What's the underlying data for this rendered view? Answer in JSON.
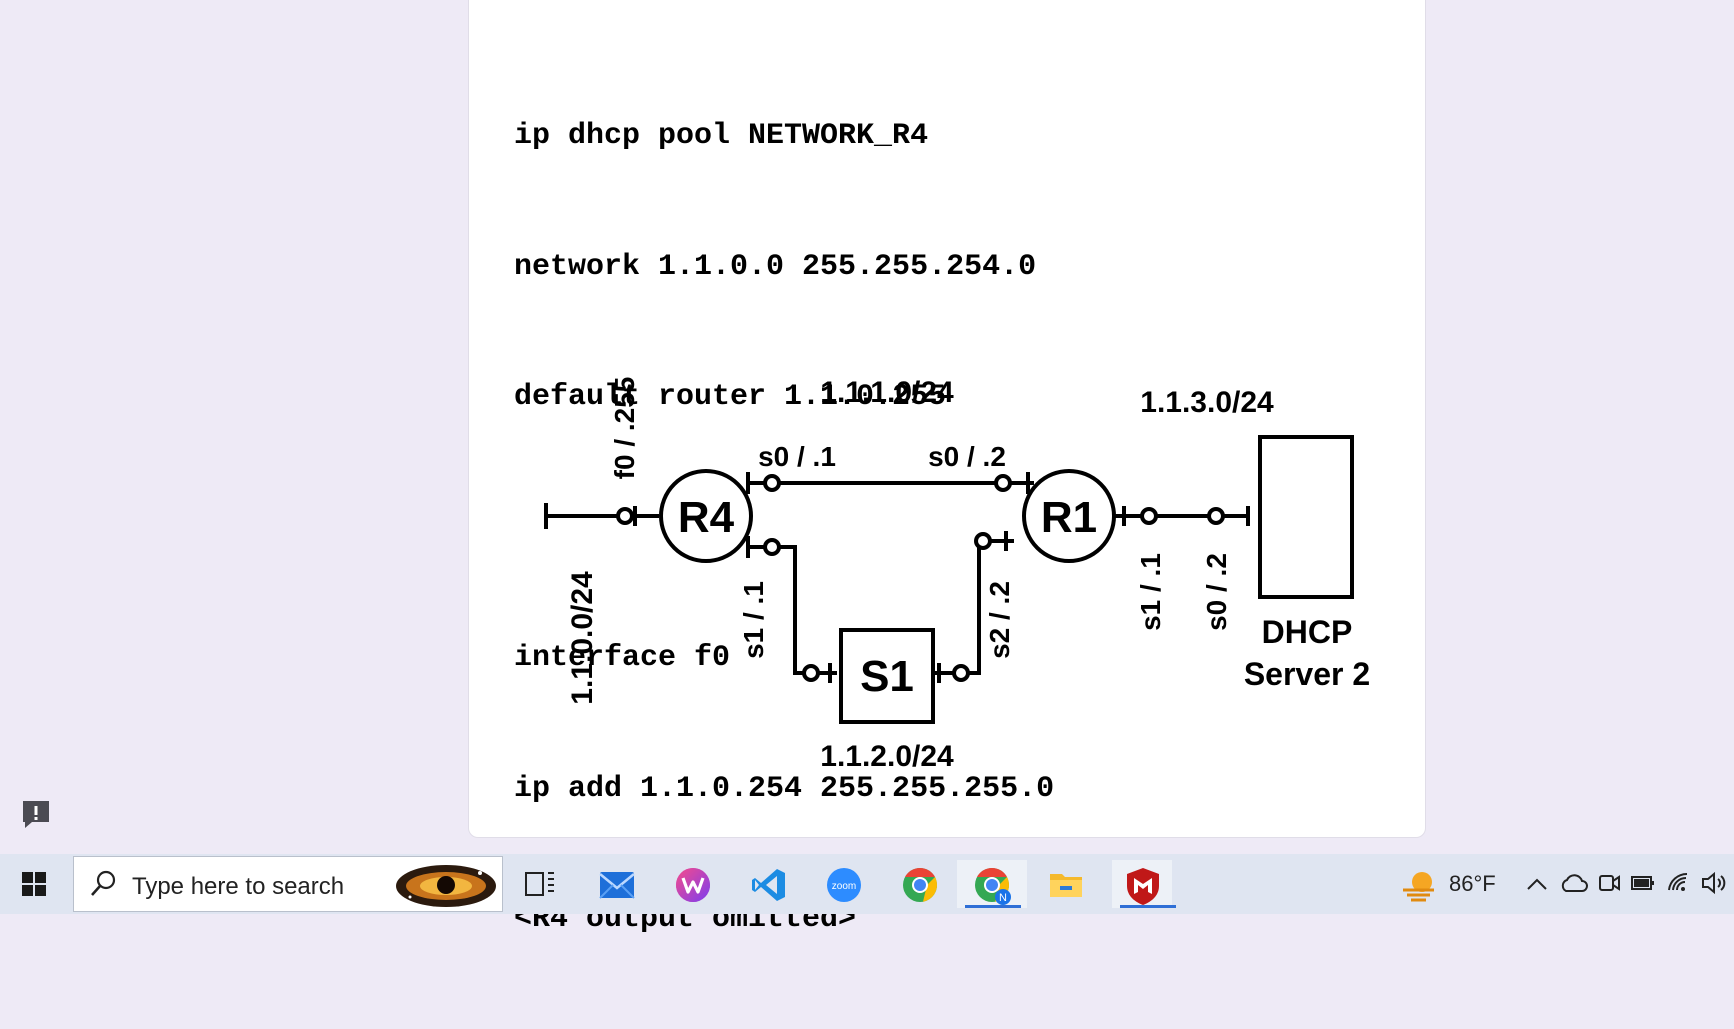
{
  "code_lines": [
    "ip dhcp pool NETWORK_R4",
    "network 1.1.0.0 255.255.254.0",
    "default router 1.1.0.255",
    "",
    "interface f0",
    "ip add 1.1.0.254 255.255.255.0",
    "<R4 output omitted>"
  ],
  "diagram": {
    "nodes": {
      "r4": "R4",
      "r1": "R1",
      "s1": "S1",
      "dhcp_line1": "DHCP",
      "dhcp_line2": "Server 2"
    },
    "networks": {
      "top": "1.1.1.0/24",
      "right": "1.1.3.0/24",
      "bottom": "1.1.2.0/24",
      "left": "1.1.0.0/24"
    },
    "interfaces": {
      "r4_f0": "f0 / .255",
      "r4_s0": "s0 / .1",
      "r1_s0": "s0 / .2",
      "r4_s1": "s1 / .1",
      "s1_s2": "s2 / .2",
      "r1_s1": "s1 / .1",
      "dhcp_s0": "s0 / .2"
    }
  },
  "taskbar": {
    "search_placeholder": "Type here to search",
    "apps": [
      "task-view-icon",
      "mail-icon",
      "wps-office-icon",
      "vscode-icon",
      "zoom-icon",
      "chrome-icon",
      "chrome-profile-icon",
      "file-explorer-icon",
      "mcafee-icon"
    ],
    "zoom_label": "zoom",
    "chrome_profile_badge": "N",
    "weather_temp": "86°F"
  }
}
